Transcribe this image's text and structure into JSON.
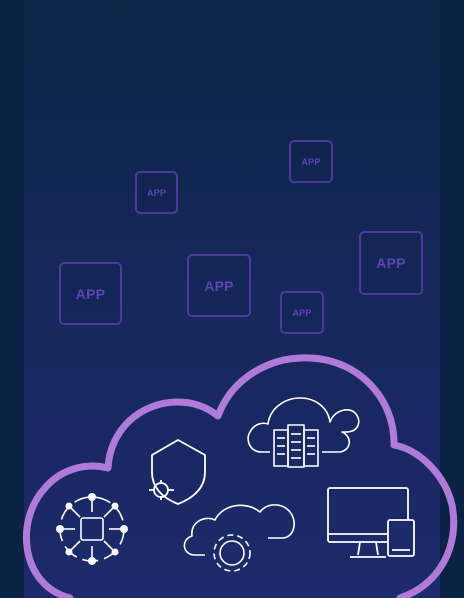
{
  "app_tiles": [
    {
      "label": "APP"
    },
    {
      "label": "APP"
    },
    {
      "label": "APP"
    },
    {
      "label": "APP"
    },
    {
      "label": "APP"
    },
    {
      "label": "APP"
    }
  ],
  "colors": {
    "background": "#0c2245",
    "tile_border": "#4a3a9a",
    "tile_text": "#5a48b0",
    "cloud_outline": "#b07ad8",
    "icon_stroke": "#ffffff"
  },
  "icons": [
    "network-hub-icon",
    "security-shield-icon",
    "cloud-servers-icon",
    "cloud-settings-icon",
    "devices-icon"
  ]
}
